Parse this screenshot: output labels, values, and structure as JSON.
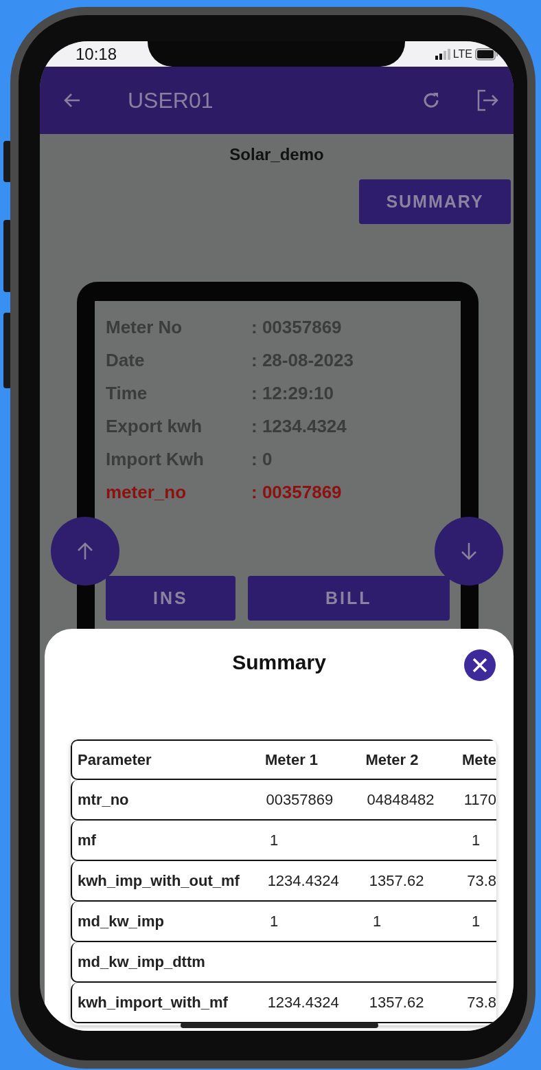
{
  "status_bar": {
    "time": "10:18",
    "network": "LTE"
  },
  "app_bar": {
    "title": "USER01"
  },
  "page_title": "Solar_demo",
  "summary_button": "SUMMARY",
  "meter_card": {
    "rows": [
      {
        "label": "Meter No",
        "value": ": 00357869",
        "highlight": false
      },
      {
        "label": "Date",
        "value": ": 28-08-2023",
        "highlight": false
      },
      {
        "label": "Time",
        "value": ": 12:29:10",
        "highlight": false
      },
      {
        "label": "Export kwh",
        "value": ": 1234.4324",
        "highlight": false
      },
      {
        "label": "Import Kwh",
        "value": ": 0",
        "highlight": false
      },
      {
        "label": "meter_no",
        "value": ": 00357869",
        "highlight": true
      }
    ]
  },
  "buttons": [
    "INS",
    "BILL"
  ],
  "summary_sheet": {
    "title": "Summary",
    "table": {
      "columns": [
        "Parameter",
        "Meter 1",
        "Meter 2",
        "Mete"
      ],
      "rows": [
        [
          "mtr_no",
          "00357869",
          "04848482",
          "1170"
        ],
        [
          "mf",
          "1",
          null,
          "1"
        ],
        [
          "kwh_imp_with_out_mf",
          "1234.4324",
          "1357.62",
          "73.8"
        ],
        [
          "md_kw_imp",
          "1",
          "1",
          "1"
        ],
        [
          "md_kw_imp_dttm",
          null,
          null,
          null
        ],
        [
          "kwh_import_with_mf",
          "1234.4324",
          "1357.62",
          "73.8"
        ]
      ]
    }
  }
}
